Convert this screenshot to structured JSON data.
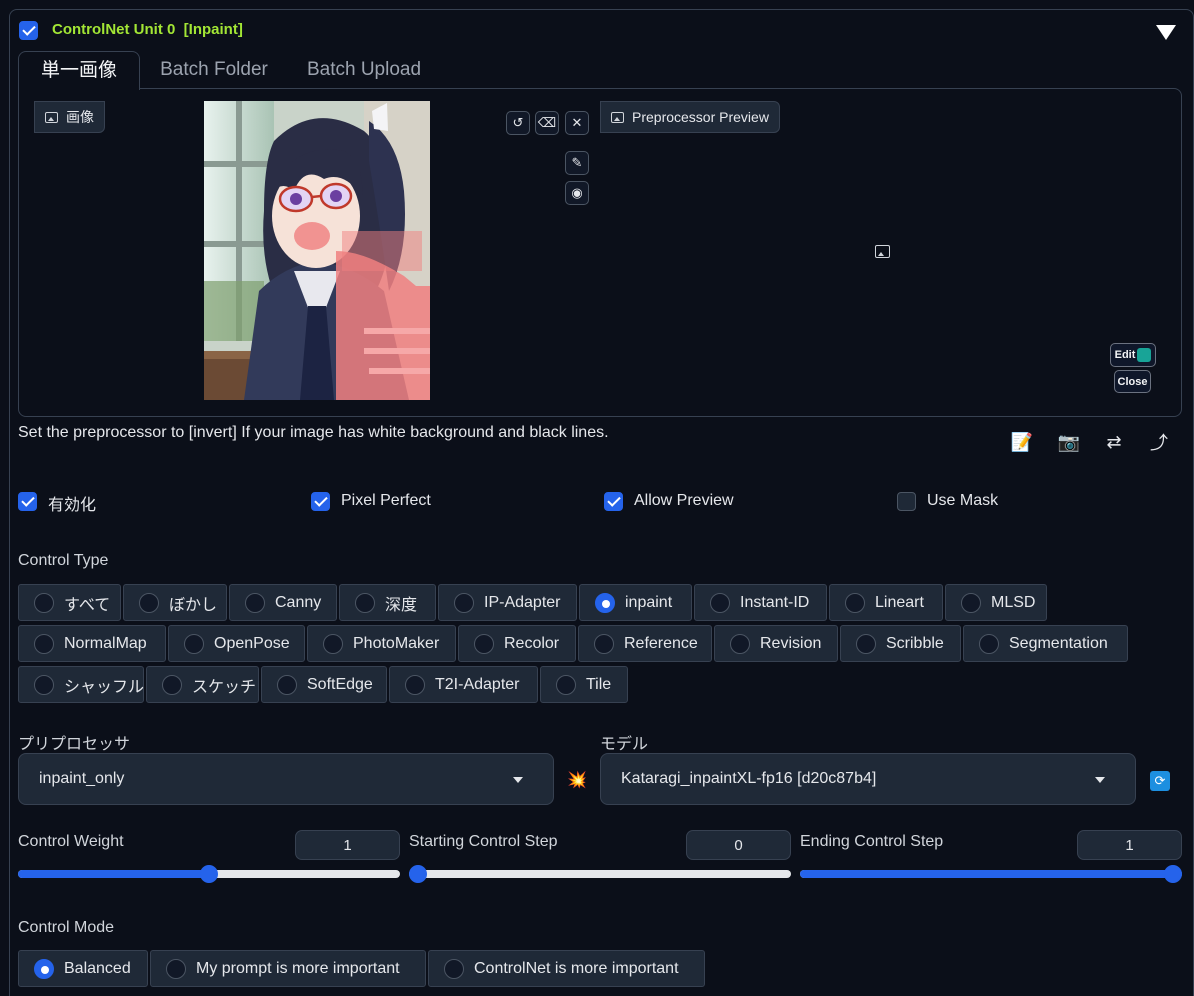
{
  "unit": {
    "title": "ControlNet Unit 0",
    "tag": "[Inpaint]",
    "enabled": true
  },
  "tabs": [
    {
      "label": "単一画像",
      "selected": true
    },
    {
      "label": "Batch Folder",
      "selected": false
    },
    {
      "label": "Batch Upload",
      "selected": false
    }
  ],
  "image_panel": {
    "label": "画像"
  },
  "preview_panel": {
    "label": "Preprocessor Preview"
  },
  "editor": {
    "edit_label": "Edit",
    "close_label": "Close"
  },
  "hint": "Set the preprocessor to [invert] If your image has white background and black lines.",
  "toolbar": {
    "notes": "📝",
    "camera": "📷",
    "swap": "⇄",
    "send": "⤴"
  },
  "options": {
    "enable": {
      "label": "有効化",
      "checked": true
    },
    "pixel_perfect": {
      "label": "Pixel Perfect",
      "checked": true
    },
    "allow_preview": {
      "label": "Allow Preview",
      "checked": true
    },
    "use_mask": {
      "label": "Use Mask",
      "checked": false
    }
  },
  "control_type": {
    "label": "Control Type",
    "items": [
      "すべて",
      "ぼかし",
      "Canny",
      "深度",
      "IP-Adapter",
      "inpaint",
      "Instant-ID",
      "Lineart",
      "MLSD",
      "NormalMap",
      "OpenPose",
      "PhotoMaker",
      "Recolor",
      "Reference",
      "Revision",
      "Scribble",
      "Segmentation",
      "シャッフル",
      "スケッチ",
      "SoftEdge",
      "T2I-Adapter",
      "Tile"
    ],
    "selected": "inpaint"
  },
  "preprocessor": {
    "label": "プリプロセッサ",
    "value": "inpaint_only",
    "run_icon": "💥"
  },
  "model": {
    "label": "モデル",
    "value": "Kataragi_inpaintXL-fp16 [d20c87b4]",
    "refresh_icon": "🔄"
  },
  "sliders": {
    "weight": {
      "label": "Control Weight",
      "value": "1",
      "fraction": 0.5
    },
    "start": {
      "label": "Starting Control Step",
      "value": "0",
      "fraction": 0.0
    },
    "end": {
      "label": "Ending Control Step",
      "value": "1",
      "fraction": 1.0
    }
  },
  "control_mode": {
    "label": "Control Mode",
    "items": [
      "Balanced",
      "My prompt is more important",
      "ControlNet is more important"
    ],
    "selected": "Balanced"
  },
  "colors": {
    "accent": "#2563eb",
    "title_green": "#a3e635",
    "background": "#0b0f19",
    "mask": "#f08080"
  }
}
